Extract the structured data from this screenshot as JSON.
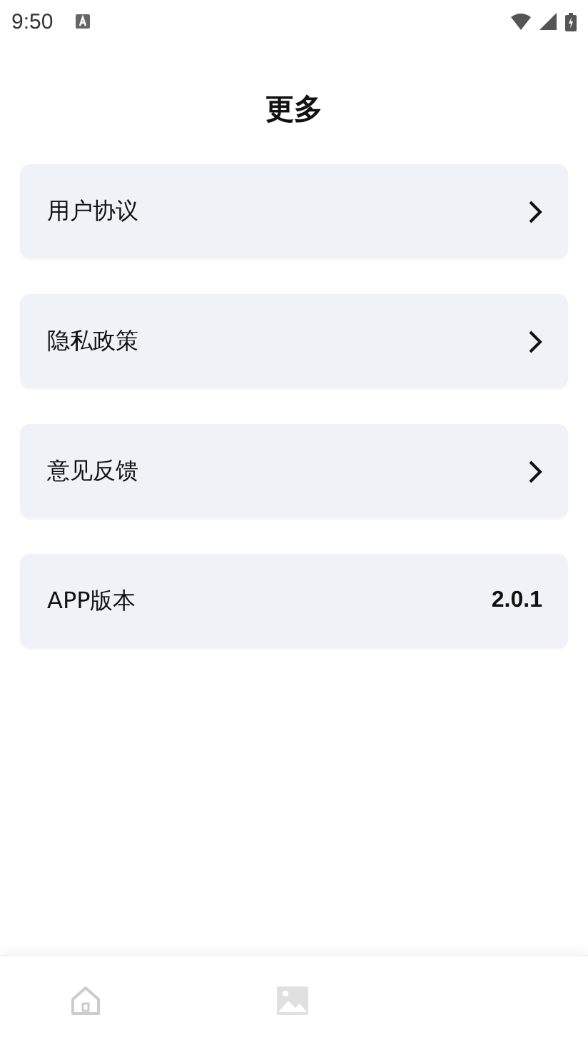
{
  "status_bar": {
    "time": "9:50"
  },
  "title": "更多",
  "items": [
    {
      "kind": "link",
      "label": "用户协议"
    },
    {
      "kind": "link",
      "label": "隐私政策"
    },
    {
      "kind": "link",
      "label": "意见反馈"
    },
    {
      "kind": "value",
      "label": "APP版本",
      "value": "2.0.1"
    }
  ],
  "bottom_nav": [
    {
      "kind": "home"
    },
    {
      "kind": "picture"
    }
  ]
}
